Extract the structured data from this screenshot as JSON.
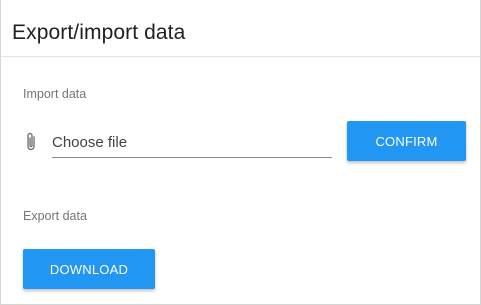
{
  "header": {
    "title": "Export/import data"
  },
  "import_section": {
    "label": "Import data",
    "file_placeholder": "Choose file",
    "confirm_label": "CONFIRM"
  },
  "export_section": {
    "label": "Export data",
    "download_label": "DOWNLOAD"
  },
  "colors": {
    "accent": "#2196f3",
    "title_text": "#212121",
    "label_text": "#757575"
  },
  "icons": {
    "attach": "paperclip-icon"
  }
}
